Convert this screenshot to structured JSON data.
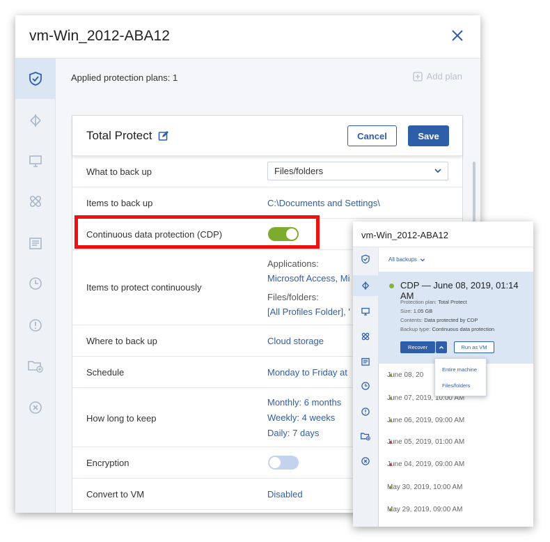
{
  "main": {
    "title": "vm-Win_2012-ABA12",
    "applied_plans": "Applied protection plans: 1",
    "add_plan": "Add plan",
    "rail_icons": [
      "shield-check-icon",
      "backup-icon",
      "monitor-icon",
      "patch-icon",
      "document-icon",
      "clock-icon",
      "alert-icon",
      "folder-add-icon",
      "cancel-icon"
    ]
  },
  "plan": {
    "name": "Total Protect",
    "cancel_label": "Cancel",
    "save_label": "Save",
    "rows": {
      "what_to_back_up": {
        "label": "What to back up",
        "value": "Files/folders"
      },
      "items_to_back_up": {
        "label": "Items to back up",
        "value": "C:\\Documents and Settings\\"
      },
      "cdp": {
        "label": "Continuous data protection (CDP)",
        "enabled": true
      },
      "items_continuous": {
        "label": "Items to protect continuously",
        "applications_label": "Applications:",
        "applications_value": "Microsoft Access, Mi",
        "files_label": "Files/folders:",
        "files_value": "[All Profiles Folder], '"
      },
      "where": {
        "label": "Where to back up",
        "value": "Cloud storage"
      },
      "schedule": {
        "label": "Schedule",
        "value": "Monday to Friday at"
      },
      "retention": {
        "label": "How long to keep",
        "monthly": "Monthly: 6 months",
        "weekly": "Weekly: 4 weeks",
        "daily": "Daily: 7 days"
      },
      "encryption": {
        "label": "Encryption",
        "enabled": false
      },
      "convert_vm": {
        "label": "Convert to VM",
        "value": "Disabled"
      }
    }
  },
  "overlay": {
    "title": "vm-Win_2012-ABA12",
    "all_backups": "All backups",
    "cdp_entry": {
      "title": "CDP — June 08, 2019, 01:14 AM",
      "protection_plan_key": "Protection plan:",
      "protection_plan_value": "Total Protect",
      "size_key": "Size:",
      "size_value": "1.05 GB",
      "contents_key": "Contents:",
      "contents_value": "Data protected by CDP",
      "backup_type_key": "Backup type:",
      "backup_type_value": "Continuous data protection",
      "recover_label": "Recover",
      "run_as_vm_label": "Run as VM"
    },
    "recover_menu": [
      "Entire machine",
      "Files/folders"
    ],
    "backups": [
      {
        "label": "June 08, 20",
        "status": "ok"
      },
      {
        "label": "June 07, 2019, 10:00 AM",
        "status": "ok"
      },
      {
        "label": "June 06, 2019, 09:00 AM",
        "status": "ok"
      },
      {
        "label": "June 05, 2019, 01:00 AM",
        "status": "error"
      },
      {
        "label": "June 04, 2019, 09:00 AM",
        "status": "error"
      },
      {
        "label": "May 30, 2019, 10:00 AM",
        "status": "ok"
      },
      {
        "label": "May 29, 2019, 09:00 AM",
        "status": "ok"
      }
    ]
  },
  "colors": {
    "accent": "#2f5ea8",
    "toggle_on": "#7cab2f",
    "toggle_off": "#c3d3ee",
    "ok": "#80b43b",
    "error": "#d93025",
    "highlight": "#ee1111"
  }
}
